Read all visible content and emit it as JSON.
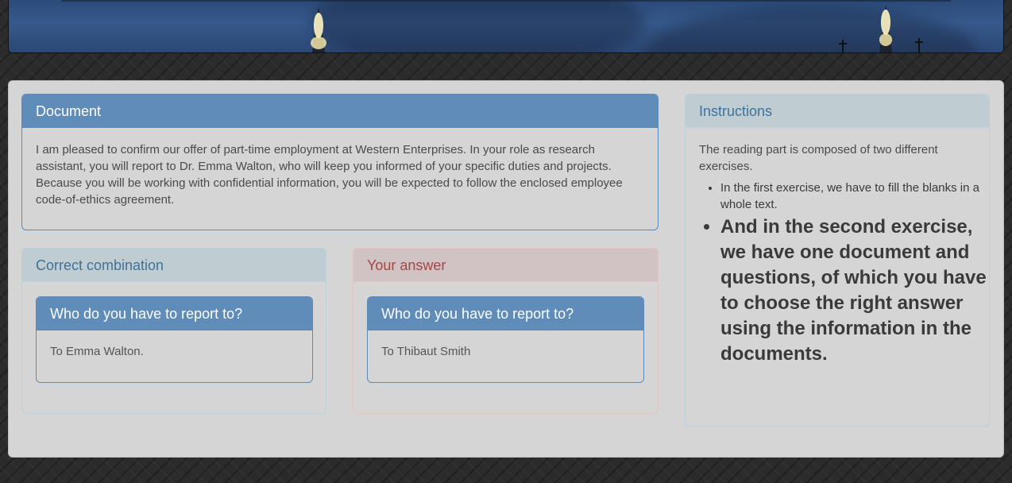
{
  "document": {
    "title": "Document",
    "text": "I am pleased to confirm our offer of part-time employment at Western Enterprises. In your role as research assistant, you will report to Dr. Emma Walton, who will keep you informed of your specific duties and projects. Because you will be working with confidential information, you will be expected to follow the enclosed employee code-of-ethics agreement."
  },
  "correct": {
    "title": "Correct combination",
    "question": "Who do you have to report to?",
    "answer": "To Emma Walton."
  },
  "your_answer": {
    "title": "Your answer",
    "question": "Who do you have to report to?",
    "answer": "To Thibaut Smith"
  },
  "instructions": {
    "title": "Instructions",
    "intro": "The reading part is composed of two different exercises.",
    "items": [
      "In the first exercise, we have to fill the blanks in a whole text.",
      "And in the second exercise, we have one document and questions, of which you have to choose the right answer using the information in the documents."
    ]
  }
}
